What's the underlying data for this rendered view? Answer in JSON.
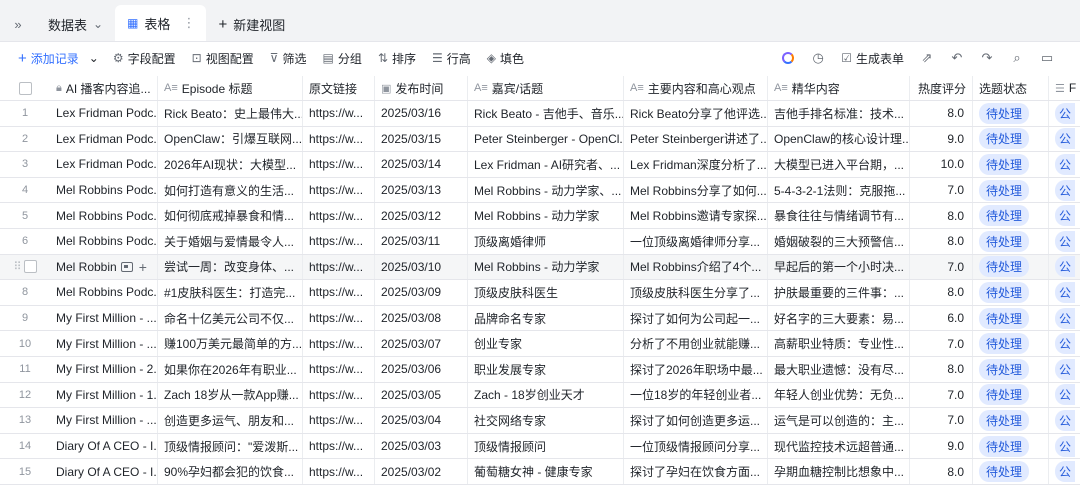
{
  "tabs": {
    "table_name": "数据表",
    "active_view": "表格",
    "new_view": "新建视图"
  },
  "toolbar": {
    "add_record": "添加记录",
    "field_config": "字段配置",
    "view_config": "视图配置",
    "filter": "筛选",
    "group": "分组",
    "sort": "排序",
    "row_height": "行高",
    "fill_color": "填色",
    "generate_form": "生成表单"
  },
  "columns": [
    {
      "label": "AI 播客内容追...",
      "icon": "lock-icon"
    },
    {
      "label": "Episode 标题",
      "icon": "text-icon"
    },
    {
      "label": "原文链接",
      "icon": ""
    },
    {
      "label": "发布时间",
      "icon": "calendar-icon"
    },
    {
      "label": "嘉宾/话题",
      "icon": "text-icon"
    },
    {
      "label": "主要内容和高心观点",
      "icon": "text-icon"
    },
    {
      "label": "精华内容",
      "icon": "text-icon"
    },
    {
      "label": "热度评分",
      "icon": ""
    },
    {
      "label": "选题状态",
      "icon": ""
    },
    {
      "label": "F",
      "icon": "list-icon"
    }
  ],
  "rows": [
    {
      "num": "1",
      "podcast": "Lex Fridman Podc...",
      "episode": "Rick Beato：史上最伟大...",
      "link": "https://w...",
      "date": "2025/03/16",
      "guest": "Rick Beato - 吉他手、音乐...",
      "main": "Rick Beato分享了他评选...",
      "essence": "吉他手排名标准：技术...",
      "heat": "8.0",
      "status": "待处理",
      "last": "公"
    },
    {
      "num": "2",
      "podcast": "Lex Fridman Podc...",
      "episode": "OpenClaw：引爆互联网...",
      "link": "https://w...",
      "date": "2025/03/15",
      "guest": "Peter Steinberger - OpenCl...",
      "main": "Peter Steinberger讲述了...",
      "essence": "OpenClaw的核心设计理...",
      "heat": "9.0",
      "status": "待处理",
      "last": "公"
    },
    {
      "num": "3",
      "podcast": "Lex Fridman Podc...",
      "episode": "2026年AI现状：大模型...",
      "link": "https://w...",
      "date": "2025/03/14",
      "guest": "Lex Fridman - AI研究者、...",
      "main": "Lex Fridman深度分析了...",
      "essence": "大模型已进入平台期，...",
      "heat": "10.0",
      "status": "待处理",
      "last": "公"
    },
    {
      "num": "4",
      "podcast": "Mel Robbins Podc...",
      "episode": "如何打造有意义的生活...",
      "link": "https://w...",
      "date": "2025/03/13",
      "guest": "Mel Robbins - 动力学家、...",
      "main": "Mel Robbins分享了如何...",
      "essence": "5-4-3-2-1法则：克服拖...",
      "heat": "7.0",
      "status": "待处理",
      "last": "公"
    },
    {
      "num": "5",
      "podcast": "Mel Robbins Podc...",
      "episode": "如何彻底戒掉暴食和情...",
      "link": "https://w...",
      "date": "2025/03/12",
      "guest": "Mel Robbins - 动力学家",
      "main": "Mel Robbins邀请专家探...",
      "essence": "暴食往往与情绪调节有...",
      "heat": "8.0",
      "status": "待处理",
      "last": "公"
    },
    {
      "num": "6",
      "podcast": "Mel Robbins Podc...",
      "episode": "关于婚姻与爱情最令人...",
      "link": "https://w...",
      "date": "2025/03/11",
      "guest": "顶级离婚律师",
      "main": "一位顶级离婚律师分享...",
      "essence": "婚姻破裂的三大预警信...",
      "heat": "8.0",
      "status": "待处理",
      "last": "公"
    },
    {
      "num": "",
      "podcast": "Mel Robbin",
      "episode": "尝试一周：改变身体、...",
      "link": "https://w...",
      "date": "2025/03/10",
      "guest": "Mel Robbins - 动力学家",
      "main": "Mel Robbins介绍了4个...",
      "essence": "早起后的第一个小时决...",
      "heat": "7.0",
      "status": "待处理",
      "last": "公"
    },
    {
      "num": "8",
      "podcast": "Mel Robbins Podc...",
      "episode": "#1皮肤科医生：打造完...",
      "link": "https://w...",
      "date": "2025/03/09",
      "guest": "顶级皮肤科医生",
      "main": "顶级皮肤科医生分享了...",
      "essence": "护肤最重要的三件事：...",
      "heat": "8.0",
      "status": "待处理",
      "last": "公"
    },
    {
      "num": "9",
      "podcast": "My First Million - ...",
      "episode": "命名十亿美元公司不仅...",
      "link": "https://w...",
      "date": "2025/03/08",
      "guest": "品牌命名专家",
      "main": "探讨了如何为公司起一...",
      "essence": "好名字的三大要素：易...",
      "heat": "6.0",
      "status": "待处理",
      "last": "公"
    },
    {
      "num": "10",
      "podcast": "My First Million - ...",
      "episode": "赚100万美元最简单的方...",
      "link": "https://w...",
      "date": "2025/03/07",
      "guest": "创业专家",
      "main": "分析了不用创业就能赚...",
      "essence": "高薪职业特质：专业性...",
      "heat": "7.0",
      "status": "待处理",
      "last": "公"
    },
    {
      "num": "11",
      "podcast": "My First Million - 2...",
      "episode": "如果你在2026年有职业...",
      "link": "https://w...",
      "date": "2025/03/06",
      "guest": "职业发展专家",
      "main": "探讨了2026年职场中最...",
      "essence": "最大职业遗憾：没有尽...",
      "heat": "8.0",
      "status": "待处理",
      "last": "公"
    },
    {
      "num": "12",
      "podcast": "My First Million - 1...",
      "episode": "Zach 18岁从一款App赚...",
      "link": "https://w...",
      "date": "2025/03/05",
      "guest": "Zach - 18岁创业天才",
      "main": "一位18岁的年轻创业者...",
      "essence": "年轻人创业优势：无负...",
      "heat": "7.0",
      "status": "待处理",
      "last": "公"
    },
    {
      "num": "13",
      "podcast": "My First Million - ...",
      "episode": "创造更多运气、朋友和...",
      "link": "https://w...",
      "date": "2025/03/04",
      "guest": "社交网络专家",
      "main": "探讨了如何创造更多运...",
      "essence": "运气是可以创造的：主...",
      "heat": "7.0",
      "status": "待处理",
      "last": "公"
    },
    {
      "num": "14",
      "podcast": "Diary Of A CEO - I...",
      "episode": "顶级情报顾问：\"爱泼斯...",
      "link": "https://w...",
      "date": "2025/03/03",
      "guest": "顶级情报顾问",
      "main": "一位顶级情报顾问分享...",
      "essence": "现代监控技术远超普通...",
      "heat": "9.0",
      "status": "待处理",
      "last": "公"
    },
    {
      "num": "15",
      "podcast": "Diary Of A CEO - I...",
      "episode": "90%孕妇都会犯的饮食...",
      "link": "https://w...",
      "date": "2025/03/02",
      "guest": "葡萄糖女神 - 健康专家",
      "main": "探讨了孕妇在饮食方面...",
      "essence": "孕期血糖控制比想象中...",
      "heat": "8.0",
      "status": "待处理",
      "last": "公"
    }
  ]
}
